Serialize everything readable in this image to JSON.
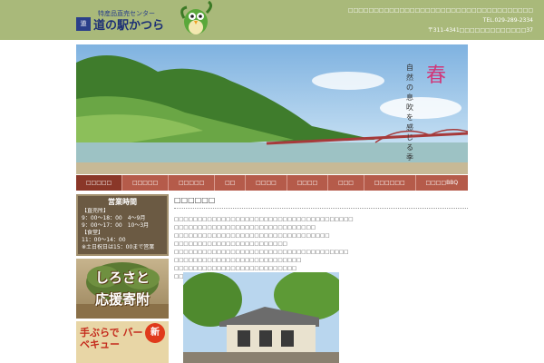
{
  "header": {
    "logo_subtitle": "特産品直売センター",
    "logo_mark": "道",
    "logo_title": "道の駅かつら",
    "info_lines": [
      "□□□□□□□□□□□□□□□□□□□□□□□□□□□□□□□□□□□□",
      "TEL.029-289-2334",
      "〒311-4341□□□□□□□□□□□□□37"
    ]
  },
  "hero": {
    "season": "春",
    "tagline": "自然の息吹を感じる季"
  },
  "nav": {
    "items": [
      "□□□□□",
      "□□□□□",
      "□□□□□",
      "□□",
      "□□□□",
      "□□□□",
      "□□□",
      "□□□□□□",
      "□□□□BBQ"
    ],
    "active_index": 0
  },
  "sidebar": {
    "hours": {
      "title": "営業時間",
      "rows": [
        "【直売所】",
        "9：00～18：00　4～9月",
        "9：00～17：00　10～3月",
        "【食堂】",
        "11：00～14：00",
        "※土日祝日は15：00まで営業"
      ]
    },
    "furusato_line1": "しろさと",
    "furusato_line2": "応援寄附",
    "bbq_text": "手ぶらで バーベキュー",
    "bbq_badge": "新"
  },
  "main": {
    "title": "□□□□□□",
    "paragraphs": [
      "□□□□□□□□□□□□□□□□□□□□□□□□□□□□□□□□□□□□□□",
      "□□□□□□□□□□□□□□□□□□□□□□□□□□□□□□",
      "□□□□□□□□□□□□□□□□□□□□□□□□□□□□□□□□□",
      "□□□□□□□□□□□□□□□□□□□□□□□□",
      "□□□□□□□□□□□□□□□□□□□□□□□□□□□□□□□□□□□□□",
      "□□□□□□□□□□□□□□□□□□□□□□□□□□□",
      "□□□□□□□□□□□□□□□□□□□□□□□□□□",
      "□□□□□□□□□□□□□□□□□□□□□□□□□□□□"
    ]
  }
}
